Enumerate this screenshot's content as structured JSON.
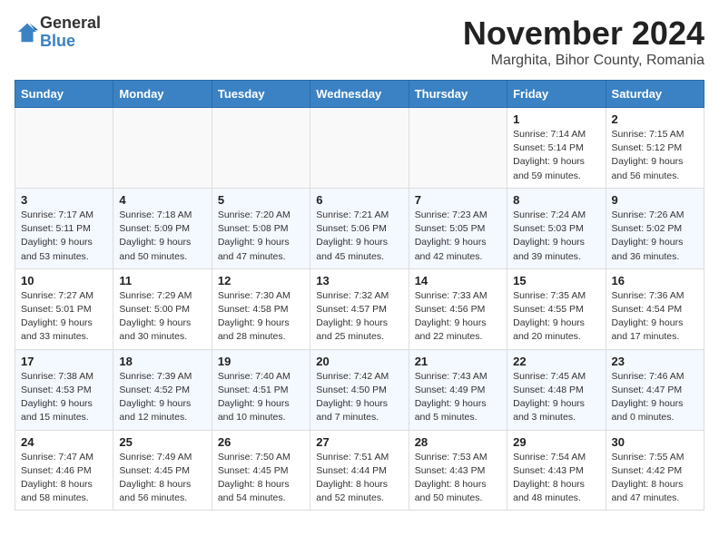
{
  "header": {
    "logo_general": "General",
    "logo_blue": "Blue",
    "title": "November 2024",
    "subtitle": "Marghita, Bihor County, Romania"
  },
  "weekdays": [
    "Sunday",
    "Monday",
    "Tuesday",
    "Wednesday",
    "Thursday",
    "Friday",
    "Saturday"
  ],
  "weeks": [
    [
      {
        "day": "",
        "info": ""
      },
      {
        "day": "",
        "info": ""
      },
      {
        "day": "",
        "info": ""
      },
      {
        "day": "",
        "info": ""
      },
      {
        "day": "",
        "info": ""
      },
      {
        "day": "1",
        "info": "Sunrise: 7:14 AM\nSunset: 5:14 PM\nDaylight: 9 hours and 59 minutes."
      },
      {
        "day": "2",
        "info": "Sunrise: 7:15 AM\nSunset: 5:12 PM\nDaylight: 9 hours and 56 minutes."
      }
    ],
    [
      {
        "day": "3",
        "info": "Sunrise: 7:17 AM\nSunset: 5:11 PM\nDaylight: 9 hours and 53 minutes."
      },
      {
        "day": "4",
        "info": "Sunrise: 7:18 AM\nSunset: 5:09 PM\nDaylight: 9 hours and 50 minutes."
      },
      {
        "day": "5",
        "info": "Sunrise: 7:20 AM\nSunset: 5:08 PM\nDaylight: 9 hours and 47 minutes."
      },
      {
        "day": "6",
        "info": "Sunrise: 7:21 AM\nSunset: 5:06 PM\nDaylight: 9 hours and 45 minutes."
      },
      {
        "day": "7",
        "info": "Sunrise: 7:23 AM\nSunset: 5:05 PM\nDaylight: 9 hours and 42 minutes."
      },
      {
        "day": "8",
        "info": "Sunrise: 7:24 AM\nSunset: 5:03 PM\nDaylight: 9 hours and 39 minutes."
      },
      {
        "day": "9",
        "info": "Sunrise: 7:26 AM\nSunset: 5:02 PM\nDaylight: 9 hours and 36 minutes."
      }
    ],
    [
      {
        "day": "10",
        "info": "Sunrise: 7:27 AM\nSunset: 5:01 PM\nDaylight: 9 hours and 33 minutes."
      },
      {
        "day": "11",
        "info": "Sunrise: 7:29 AM\nSunset: 5:00 PM\nDaylight: 9 hours and 30 minutes."
      },
      {
        "day": "12",
        "info": "Sunrise: 7:30 AM\nSunset: 4:58 PM\nDaylight: 9 hours and 28 minutes."
      },
      {
        "day": "13",
        "info": "Sunrise: 7:32 AM\nSunset: 4:57 PM\nDaylight: 9 hours and 25 minutes."
      },
      {
        "day": "14",
        "info": "Sunrise: 7:33 AM\nSunset: 4:56 PM\nDaylight: 9 hours and 22 minutes."
      },
      {
        "day": "15",
        "info": "Sunrise: 7:35 AM\nSunset: 4:55 PM\nDaylight: 9 hours and 20 minutes."
      },
      {
        "day": "16",
        "info": "Sunrise: 7:36 AM\nSunset: 4:54 PM\nDaylight: 9 hours and 17 minutes."
      }
    ],
    [
      {
        "day": "17",
        "info": "Sunrise: 7:38 AM\nSunset: 4:53 PM\nDaylight: 9 hours and 15 minutes."
      },
      {
        "day": "18",
        "info": "Sunrise: 7:39 AM\nSunset: 4:52 PM\nDaylight: 9 hours and 12 minutes."
      },
      {
        "day": "19",
        "info": "Sunrise: 7:40 AM\nSunset: 4:51 PM\nDaylight: 9 hours and 10 minutes."
      },
      {
        "day": "20",
        "info": "Sunrise: 7:42 AM\nSunset: 4:50 PM\nDaylight: 9 hours and 7 minutes."
      },
      {
        "day": "21",
        "info": "Sunrise: 7:43 AM\nSunset: 4:49 PM\nDaylight: 9 hours and 5 minutes."
      },
      {
        "day": "22",
        "info": "Sunrise: 7:45 AM\nSunset: 4:48 PM\nDaylight: 9 hours and 3 minutes."
      },
      {
        "day": "23",
        "info": "Sunrise: 7:46 AM\nSunset: 4:47 PM\nDaylight: 9 hours and 0 minutes."
      }
    ],
    [
      {
        "day": "24",
        "info": "Sunrise: 7:47 AM\nSunset: 4:46 PM\nDaylight: 8 hours and 58 minutes."
      },
      {
        "day": "25",
        "info": "Sunrise: 7:49 AM\nSunset: 4:45 PM\nDaylight: 8 hours and 56 minutes."
      },
      {
        "day": "26",
        "info": "Sunrise: 7:50 AM\nSunset: 4:45 PM\nDaylight: 8 hours and 54 minutes."
      },
      {
        "day": "27",
        "info": "Sunrise: 7:51 AM\nSunset: 4:44 PM\nDaylight: 8 hours and 52 minutes."
      },
      {
        "day": "28",
        "info": "Sunrise: 7:53 AM\nSunset: 4:43 PM\nDaylight: 8 hours and 50 minutes."
      },
      {
        "day": "29",
        "info": "Sunrise: 7:54 AM\nSunset: 4:43 PM\nDaylight: 8 hours and 48 minutes."
      },
      {
        "day": "30",
        "info": "Sunrise: 7:55 AM\nSunset: 4:42 PM\nDaylight: 8 hours and 47 minutes."
      }
    ]
  ]
}
